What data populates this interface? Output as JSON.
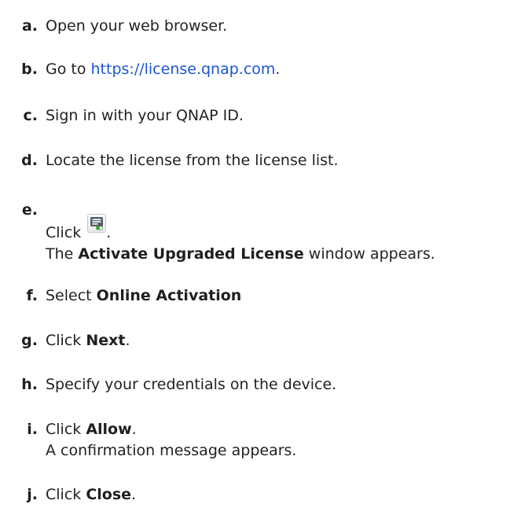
{
  "steps": [
    {
      "letter": "a.",
      "text": "Open your web browser."
    },
    {
      "letter": "b.",
      "pre": "Go to ",
      "link": "https://license.qnap.com",
      "post": "."
    },
    {
      "letter": "c.",
      "text": "Sign in with your QNAP ID."
    },
    {
      "letter": "d.",
      "text": "Locate the license from the license list."
    },
    {
      "letter": "e.",
      "pre": "Click",
      "icon": "license-activate-icon",
      "post": ".",
      "line2_pre": "The ",
      "line2_bold": "Activate Upgraded License",
      "line2_post": " window appears."
    },
    {
      "letter": "f.",
      "pre": "Select ",
      "bold": "Online Activation"
    },
    {
      "letter": "g.",
      "pre": "Click ",
      "bold": "Next",
      "post": "."
    },
    {
      "letter": "h.",
      "text": "Specify your credentials on the device."
    },
    {
      "letter": "i.",
      "pre": "Click ",
      "bold": "Allow",
      "post": ".",
      "line2": "A confirmation message appears."
    },
    {
      "letter": "j.",
      "pre": "Click ",
      "bold": "Close",
      "post": "."
    }
  ]
}
